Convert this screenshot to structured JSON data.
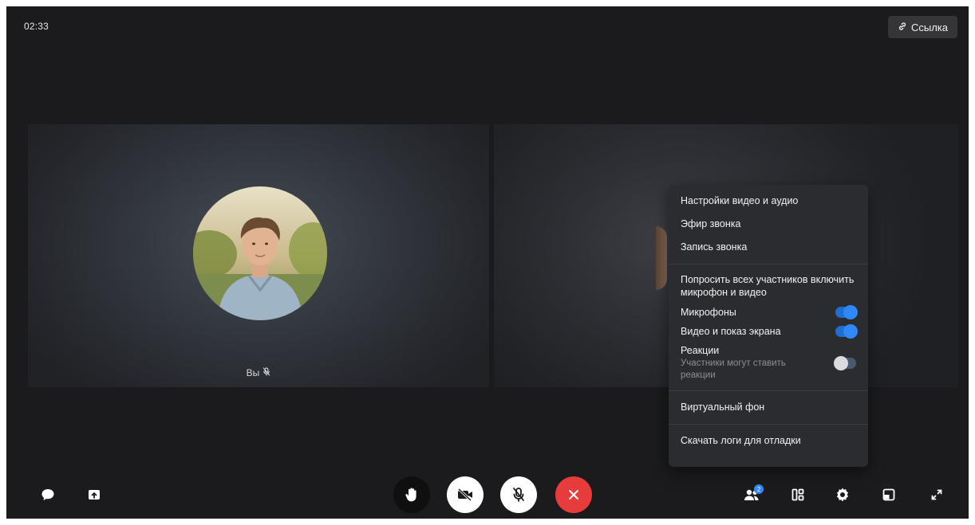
{
  "header": {
    "timer": "02:33",
    "link_label": "Ссылка"
  },
  "tiles": {
    "self_name": "Вы"
  },
  "menu": {
    "items": {
      "video_audio_settings": "Настройки видео и аудио",
      "broadcast": "Эфир звонка",
      "recording": "Запись звонка",
      "ask_all": "Попросить всех участников включить микрофон и видео",
      "microphones": "Микрофоны",
      "video_screen": "Видео и показ экрана",
      "reactions": "Реакции",
      "reactions_sub": "Участники могут ставить реакции",
      "virtual_bg": "Виртуальный фон",
      "download_logs": "Скачать логи для отладки"
    },
    "toggles": {
      "microphones": true,
      "video_screen": true,
      "reactions": false
    }
  },
  "toolbar": {
    "participants_badge": "2"
  },
  "colors": {
    "background": "#1b1b1d",
    "accent": "#2f88f5",
    "end_call": "#e83c3c"
  }
}
